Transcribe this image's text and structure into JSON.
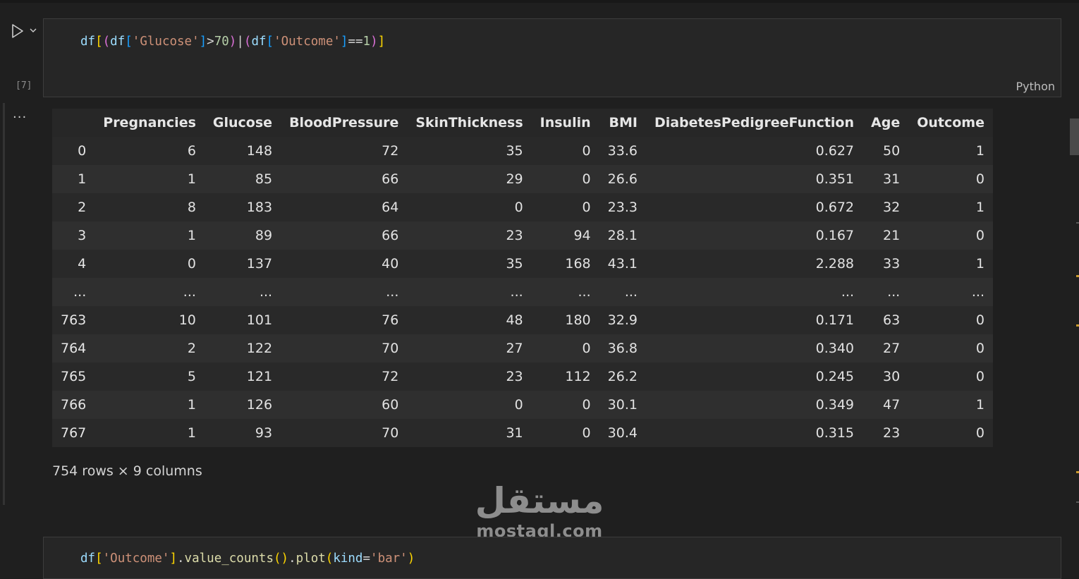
{
  "cell1": {
    "execution_count": "[7]",
    "language": "Python",
    "code": [
      {
        "t": "df",
        "c": "#9cdcfe"
      },
      {
        "t": "[",
        "c": "#ffd700"
      },
      {
        "t": "(",
        "c": "#da70d6"
      },
      {
        "t": "df",
        "c": "#9cdcfe"
      },
      {
        "t": "[",
        "c": "#179fff"
      },
      {
        "t": "'Glucose'",
        "c": "#ce9178"
      },
      {
        "t": "]",
        "c": "#179fff"
      },
      {
        "t": ">",
        "c": "#d4d4d4"
      },
      {
        "t": "70",
        "c": "#b5cea8"
      },
      {
        "t": ")",
        "c": "#da70d6"
      },
      {
        "t": "|",
        "c": "#d4d4d4"
      },
      {
        "t": "(",
        "c": "#da70d6"
      },
      {
        "t": "df",
        "c": "#9cdcfe"
      },
      {
        "t": "[",
        "c": "#179fff"
      },
      {
        "t": "'Outcome'",
        "c": "#ce9178"
      },
      {
        "t": "]",
        "c": "#179fff"
      },
      {
        "t": "==",
        "c": "#d4d4d4"
      },
      {
        "t": "1",
        "c": "#b5cea8"
      },
      {
        "t": ")",
        "c": "#da70d6"
      },
      {
        "t": "]",
        "c": "#ffd700"
      }
    ]
  },
  "output": {
    "more_actions": "...",
    "columns": [
      "",
      "Pregnancies",
      "Glucose",
      "BloodPressure",
      "SkinThickness",
      "Insulin",
      "BMI",
      "DiabetesPedigreeFunction",
      "Age",
      "Outcome"
    ],
    "rows": [
      [
        "0",
        "6",
        "148",
        "72",
        "35",
        "0",
        "33.6",
        "0.627",
        "50",
        "1"
      ],
      [
        "1",
        "1",
        "85",
        "66",
        "29",
        "0",
        "26.6",
        "0.351",
        "31",
        "0"
      ],
      [
        "2",
        "8",
        "183",
        "64",
        "0",
        "0",
        "23.3",
        "0.672",
        "32",
        "1"
      ],
      [
        "3",
        "1",
        "89",
        "66",
        "23",
        "94",
        "28.1",
        "0.167",
        "21",
        "0"
      ],
      [
        "4",
        "0",
        "137",
        "40",
        "35",
        "168",
        "43.1",
        "2.288",
        "33",
        "1"
      ],
      [
        "...",
        "...",
        "...",
        "...",
        "...",
        "...",
        "...",
        "...",
        "...",
        "..."
      ],
      [
        "763",
        "10",
        "101",
        "76",
        "48",
        "180",
        "32.9",
        "0.171",
        "63",
        "0"
      ],
      [
        "764",
        "2",
        "122",
        "70",
        "27",
        "0",
        "36.8",
        "0.340",
        "27",
        "0"
      ],
      [
        "765",
        "5",
        "121",
        "72",
        "23",
        "112",
        "26.2",
        "0.245",
        "30",
        "0"
      ],
      [
        "766",
        "1",
        "126",
        "60",
        "0",
        "0",
        "30.1",
        "0.349",
        "47",
        "1"
      ],
      [
        "767",
        "1",
        "93",
        "70",
        "31",
        "0",
        "30.4",
        "0.315",
        "23",
        "0"
      ]
    ],
    "shape_text": "754 rows × 9 columns"
  },
  "watermark": {
    "arabic": "مستقل",
    "latin": "mostaql.com"
  },
  "cell2": {
    "code": [
      {
        "t": "df",
        "c": "#9cdcfe"
      },
      {
        "t": "[",
        "c": "#ffd700"
      },
      {
        "t": "'Outcome'",
        "c": "#ce9178"
      },
      {
        "t": "]",
        "c": "#ffd700"
      },
      {
        "t": ".",
        "c": "#d4d4d4"
      },
      {
        "t": "value_counts",
        "c": "#dcdcaa"
      },
      {
        "t": "(",
        "c": "#ffd700"
      },
      {
        "t": ")",
        "c": "#ffd700"
      },
      {
        "t": ".",
        "c": "#d4d4d4"
      },
      {
        "t": "plot",
        "c": "#dcdcaa"
      },
      {
        "t": "(",
        "c": "#ffd700"
      },
      {
        "t": "kind",
        "c": "#9cdcfe"
      },
      {
        "t": "=",
        "c": "#d4d4d4"
      },
      {
        "t": "'bar'",
        "c": "#ce9178"
      },
      {
        "t": ")",
        "c": "#ffd700"
      }
    ]
  },
  "colors": {
    "background": "#1f1f1f",
    "editor": "#262626",
    "accent_marker": "#c99a2e"
  },
  "icons": {
    "run": "play-icon",
    "run_menu": "chevron-down-icon"
  }
}
